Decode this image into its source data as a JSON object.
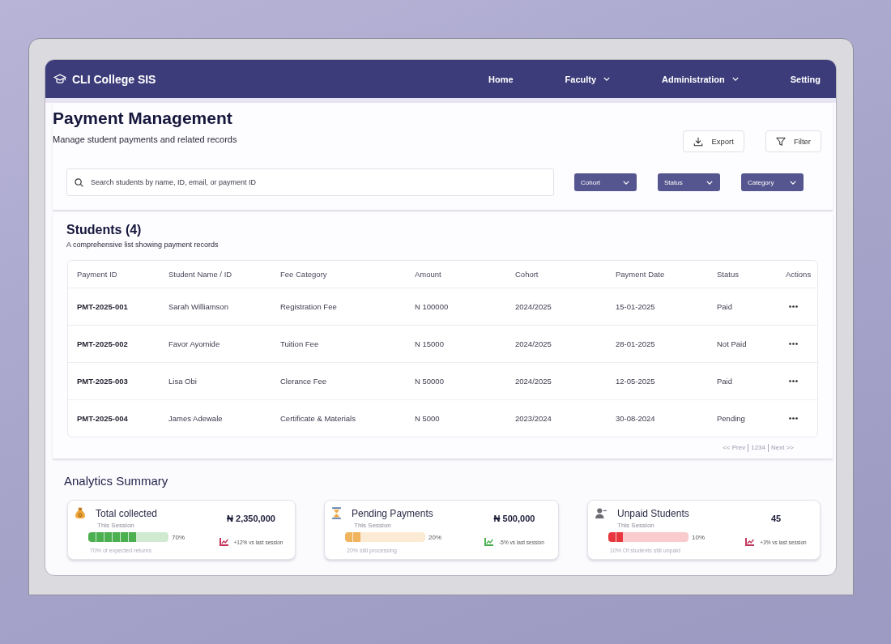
{
  "app": {
    "title": "CLI College SIS"
  },
  "nav": [
    {
      "label": "Home",
      "dropdown": false
    },
    {
      "label": "Faculty",
      "dropdown": true
    },
    {
      "label": "Administration",
      "dropdown": true
    },
    {
      "label": "Setting",
      "dropdown": false
    }
  ],
  "page": {
    "title": "Payment Management",
    "subtitle": "Manage student payments and related records"
  },
  "actions": [
    {
      "label": "Export",
      "kind": "export"
    },
    {
      "label": "Filter",
      "kind": "filter"
    }
  ],
  "search": {
    "placeholder": "Search students by name, ID, email, or payment ID"
  },
  "filters": [
    "Cohort",
    "Status",
    "Category"
  ],
  "students": {
    "title": "Students (4)",
    "subtitle": "A comprehensive list showing payment records",
    "table": {
      "columns": [
        "Payment ID",
        "Student Name / ID",
        "Fee Category",
        "Amount",
        "Cohort",
        "Payment Date",
        "Status",
        "Actions"
      ],
      "rows": [
        [
          "PMT-2025-001",
          "Sarah Williamson",
          "Registration Fee",
          "N 100000",
          "2024/2025",
          "15-01-2025",
          "Paid"
        ],
        [
          "PMT-2025-002",
          "Favor Ayomide",
          "Tuition Fee",
          "N 15000",
          "2024/2025",
          "28-01-2025",
          "Not Paid"
        ],
        [
          "PMT-2025-003",
          "Lisa Obi",
          "Clerance Fee",
          "N 50000",
          "2024/2025",
          "12-05-2025",
          "Paid"
        ],
        [
          "PMT-2025-004",
          "James Adewale",
          "Certificate & Materials",
          "N 5000",
          "2023/2024",
          "30-08-2024",
          "Pending"
        ]
      ]
    },
    "pagination": {
      "prev": "<< Prev",
      "pages": "1234",
      "next": "Next >>"
    }
  },
  "analytics": {
    "title": "Analytics Summary",
    "cards": [
      {
        "kind": "collected",
        "title": "Total collected",
        "period": "This Session",
        "level": 0.6,
        "reading": "70%",
        "note": "70% of expected returns",
        "value": "₦ 2,350,000",
        "color": "#4caf50",
        "trend": {
          "text": "+12% vs last session",
          "color": "#c2375c"
        }
      },
      {
        "kind": "pending",
        "title": "Pending Payments",
        "period": "This Session",
        "level": 0.2,
        "reading": "20%",
        "note": "20% still processing",
        "value": "₦ 500,000",
        "color": "#f0b35e",
        "trend": {
          "text": "-5% vs last session",
          "color": "#4caf50"
        }
      },
      {
        "kind": "unpaid",
        "title": "Unpaid Students",
        "period": "This Session",
        "level": 0.2,
        "reading": "10%",
        "note": "10% Of students still unpaid",
        "value": "45",
        "color": "#e8383f",
        "trend": {
          "text": "+3% vs last session",
          "color": "#c2375c"
        }
      }
    ]
  }
}
